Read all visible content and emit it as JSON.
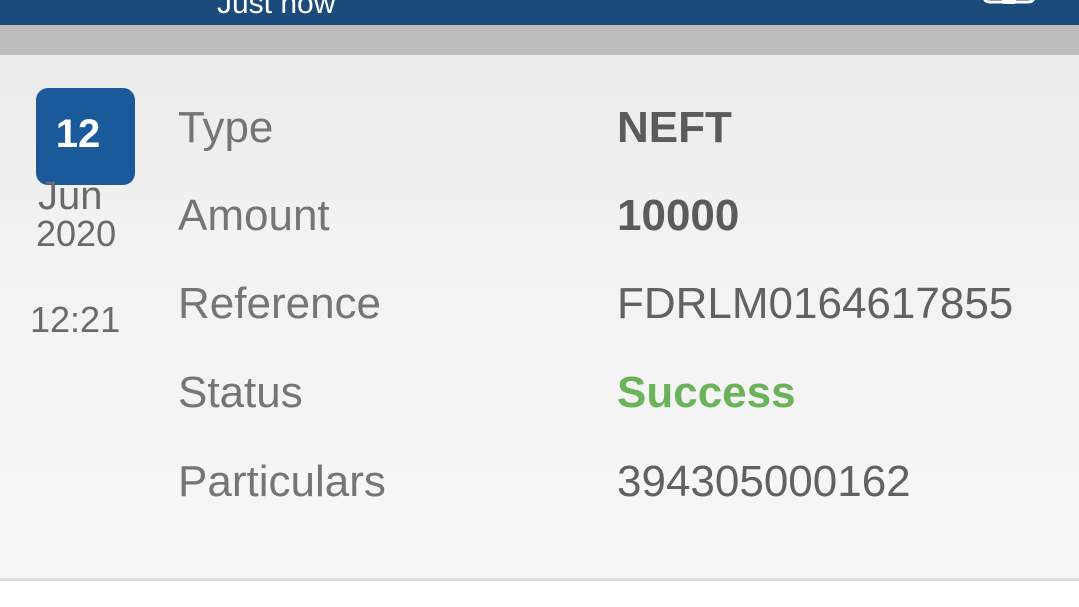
{
  "header": {
    "timestamp_text": "Just now",
    "icon": "settings-icon",
    "background_color": "#1a4b7a"
  },
  "transaction": {
    "date": {
      "day": "12",
      "month": "Jun",
      "year": "2020",
      "time": "12:21"
    },
    "badge_color": "#1a5a9a",
    "fields": [
      {
        "label": "Type",
        "value": "NEFT"
      },
      {
        "label": "Amount",
        "value": "10000"
      },
      {
        "label": "Reference",
        "value": "FDRLM0164617855"
      },
      {
        "label": "Status",
        "value": "Success"
      },
      {
        "label": "Particulars",
        "value": "394305000162"
      }
    ],
    "status_color": "#6cb25a"
  }
}
